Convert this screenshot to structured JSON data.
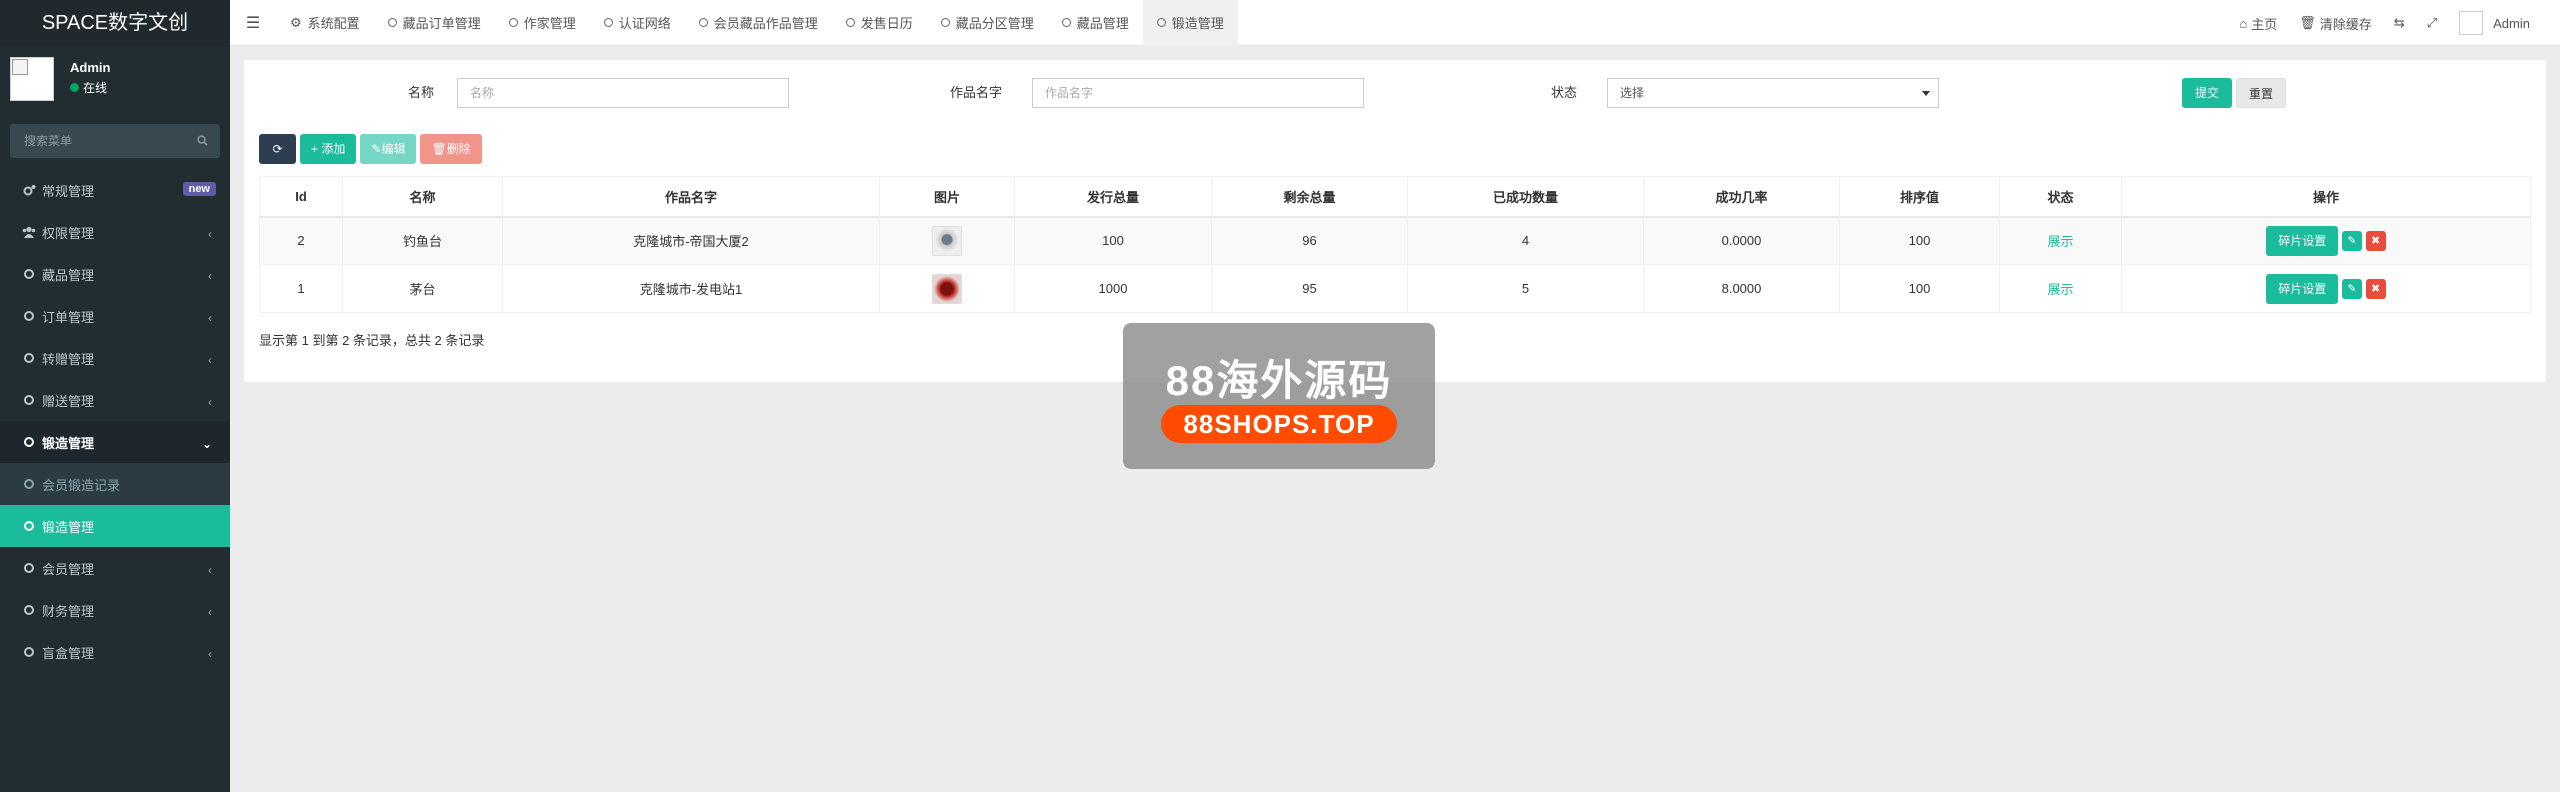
{
  "brand": "SPACE数字文创",
  "user": {
    "name": "Admin",
    "status": "在线"
  },
  "search": {
    "placeholder": "搜索菜单"
  },
  "sidebar": {
    "items": [
      {
        "label": "常规管理",
        "badge": "new"
      },
      {
        "label": "权限管理"
      },
      {
        "label": "藏品管理"
      },
      {
        "label": "订单管理"
      },
      {
        "label": "转赠管理"
      },
      {
        "label": "赠送管理"
      },
      {
        "label": "锻造管理"
      },
      {
        "label": "会员锻造记录"
      },
      {
        "label": "锻造管理"
      },
      {
        "label": "会员管理"
      },
      {
        "label": "财务管理"
      },
      {
        "label": "盲盒管理"
      }
    ]
  },
  "tabs": [
    "系统配置",
    "藏品订单管理",
    "作家管理",
    "认证网络",
    "会员藏品作品管理",
    "发售日历",
    "藏品分区管理",
    "藏品管理",
    "锻造管理"
  ],
  "topright": {
    "home": "主页",
    "clear": "清除缓存",
    "user": "Admin"
  },
  "filters": {
    "name_label": "名称",
    "name_placeholder": "名称",
    "work_label": "作品名字",
    "work_placeholder": "作品名字",
    "status_label": "状态",
    "status_value": "选择",
    "submit": "提交",
    "reset": "重置"
  },
  "toolbar": {
    "add": "添加",
    "edit": "编辑",
    "delete": "删除"
  },
  "table": {
    "headers": [
      "Id",
      "名称",
      "作品名字",
      "图片",
      "发行总量",
      "剩余总量",
      "已成功数量",
      "成功几率",
      "排序值",
      "状态",
      "操作"
    ],
    "rows": [
      {
        "id": "2",
        "name": "钓鱼台",
        "work": "克隆城市-帝国大厦2",
        "total": "100",
        "remain": "96",
        "success": "4",
        "rate": "0.0000",
        "sort": "100",
        "status": "展示",
        "action": "碎片设置"
      },
      {
        "id": "1",
        "name": "茅台",
        "work": "克隆城市-发电站1",
        "total": "1000",
        "remain": "95",
        "success": "5",
        "rate": "8.0000",
        "sort": "100",
        "status": "展示",
        "action": "碎片设置"
      }
    ]
  },
  "pagination": "显示第 1 到第 2 条记录，总共 2 条记录",
  "watermark": {
    "line1": "88海外源码",
    "line2": "88SHOPS.TOP"
  },
  "colors": {
    "accent": "#1abc9c",
    "sidebar": "#222d32",
    "danger": "#e74c3c",
    "dark": "#2c3e50"
  }
}
